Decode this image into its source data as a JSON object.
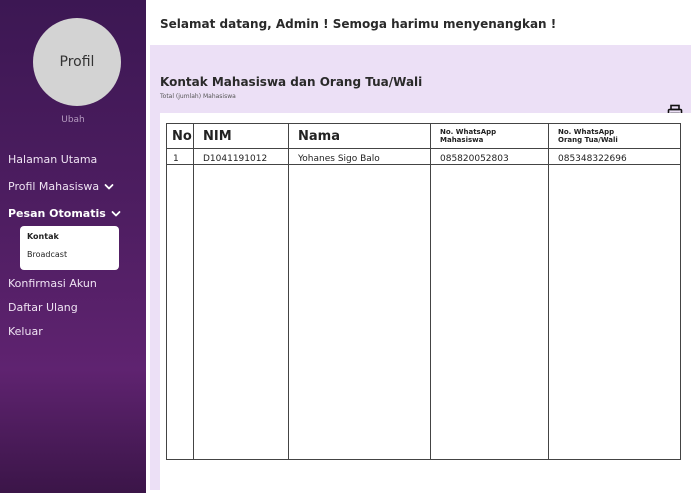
{
  "greeting": "Selamat datang, Admin ! Semoga harimu menyenangkan !",
  "sidebar": {
    "profile_label": "Profil",
    "change_label": "Ubah",
    "items": [
      {
        "label": "Halaman Utama"
      },
      {
        "label": "Profil Mahasiswa"
      },
      {
        "label": "Pesan Otomatis"
      },
      {
        "label": "Konfirmasi Akun"
      },
      {
        "label": "Daftar Ulang"
      },
      {
        "label": "Keluar"
      }
    ],
    "submenu": [
      {
        "label": "Kontak"
      },
      {
        "label": "Broadcast"
      }
    ]
  },
  "main": {
    "title": "Kontak Mahasiswa dan Orang Tua/Wali",
    "subtitle": "Total (jumlah) Mahasiswa",
    "table": {
      "headers": [
        "No",
        "NIM",
        "Nama",
        "No. WhatsApp\nMahasiswa",
        "No. WhatsApp\nOrang Tua/Wali"
      ],
      "rows": [
        [
          "1",
          "D1041191012",
          "Yohanes Sigo Balo",
          "085820052803",
          "085348322696"
        ]
      ]
    }
  },
  "colors": {
    "sidebar_top": "#3c1753",
    "sidebar_bottom": "#5f2370",
    "panel_bg": "#ece0f6"
  },
  "icons": {
    "print": "printer-icon",
    "chevron": "chevron-down-icon"
  }
}
